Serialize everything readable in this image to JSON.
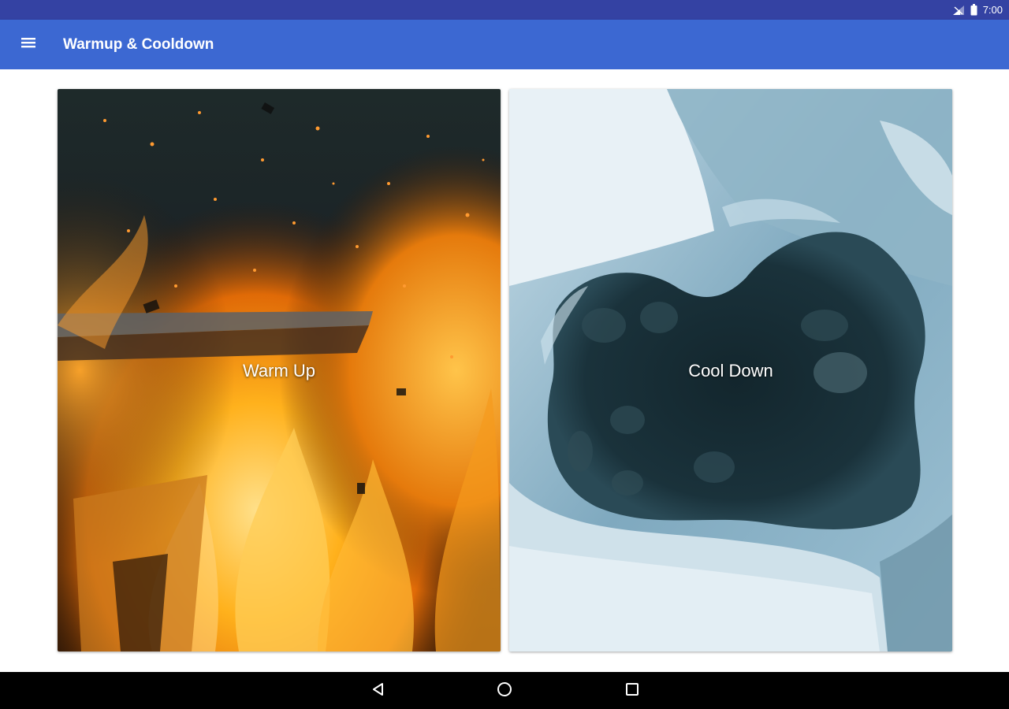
{
  "status_bar": {
    "time": "7:00",
    "icons": [
      "signal-icon",
      "battery-icon"
    ]
  },
  "app_bar": {
    "title": "Warmup & Cooldown",
    "menu_icon": "menu-icon"
  },
  "cards": [
    {
      "label": "Warm Up",
      "image": "fire-image"
    },
    {
      "label": "Cool Down",
      "image": "ice-image"
    }
  ],
  "nav_bar": {
    "icons": [
      "back-icon",
      "home-icon",
      "recents-icon"
    ]
  },
  "colors": {
    "status_bar": "#3442a3",
    "app_bar": "#3c68d2",
    "nav_bar": "#000000"
  }
}
